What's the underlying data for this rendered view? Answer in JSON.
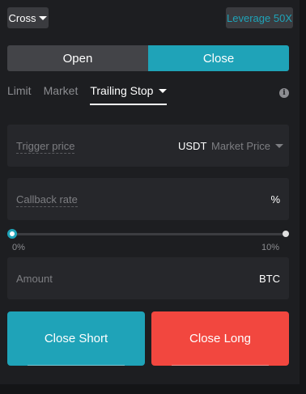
{
  "margin_mode": {
    "label": "Cross"
  },
  "leverage": {
    "label": "Leverage 50X"
  },
  "side_toggle": {
    "open": "Open",
    "close": "Close",
    "active": "Close"
  },
  "order_tabs": [
    {
      "label": "Limit"
    },
    {
      "label": "Market"
    },
    {
      "label": "Trailing Stop"
    }
  ],
  "trigger_price": {
    "label": "Trigger price",
    "unit": "USDT",
    "mode": "Market Price"
  },
  "callback_rate": {
    "label": "Callback rate",
    "unit": "%"
  },
  "slider": {
    "min_label": "0%",
    "max_label": "10%",
    "value_percent": 0
  },
  "amount": {
    "label": "Amount",
    "unit": "BTC"
  },
  "actions": {
    "close_short": "Close Short",
    "close_long": "Close Long"
  },
  "colors": {
    "accent": "#1fa3b8",
    "sell": "#f2473f",
    "background": "#1d1e21"
  }
}
